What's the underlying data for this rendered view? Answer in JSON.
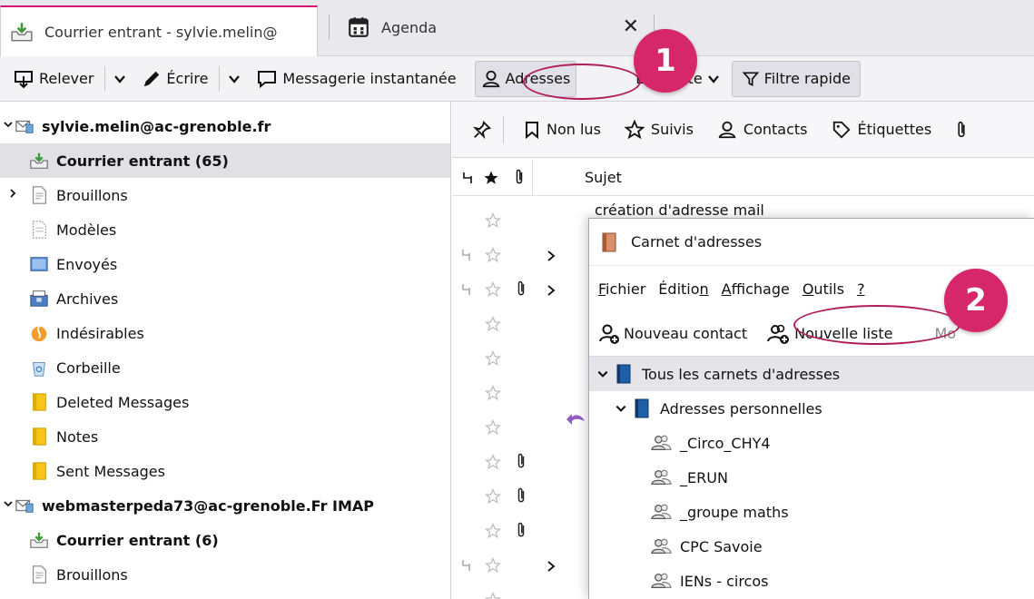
{
  "tabs": [
    {
      "label": "Courrier entrant - sylvie.melin@",
      "icon": "inbox-icon"
    },
    {
      "label": "Agenda",
      "icon": "calendar-icon",
      "close": "✕"
    }
  ],
  "toolbar": {
    "get_mail": "Relever",
    "write": "Écrire",
    "chat": "Messagerie instantanée",
    "address_book": "Adresses",
    "tag": "Étiquette",
    "quick_filter": "Filtre rapide"
  },
  "folders": [
    {
      "label": "sylvie.melin@ac-grenoble.fr",
      "icon": "account-icon",
      "bold": true,
      "twisty": "v",
      "indent": 0
    },
    {
      "label": "Courrier entrant (65)",
      "icon": "inbox-icon",
      "bold": true,
      "selected": true,
      "indent": 1
    },
    {
      "label": "Brouillons",
      "icon": "drafts-icon",
      "twisty": ">",
      "indent": 1
    },
    {
      "label": "Modèles",
      "icon": "templates-icon",
      "indent": 1
    },
    {
      "label": "Envoyés",
      "icon": "sent-icon",
      "indent": 1
    },
    {
      "label": "Archives",
      "icon": "archive-icon",
      "indent": 1
    },
    {
      "label": "Indésirables",
      "icon": "junk-icon",
      "indent": 1
    },
    {
      "label": "Corbeille",
      "icon": "trash-icon",
      "indent": 1
    },
    {
      "label": "Deleted Messages",
      "icon": "folder-icon",
      "indent": 1
    },
    {
      "label": "Notes",
      "icon": "folder-icon",
      "indent": 1
    },
    {
      "label": "Sent Messages",
      "icon": "folder-icon",
      "indent": 1
    },
    {
      "label": "webmasterpeda73@ac-grenoble.Fr IMAP",
      "icon": "account-icon",
      "bold": true,
      "twisty": "v",
      "indent": 0
    },
    {
      "label": "Courrier entrant (6)",
      "icon": "inbox-icon",
      "bold": true,
      "indent": 1
    },
    {
      "label": "Brouillons",
      "icon": "drafts-icon",
      "indent": 1
    }
  ],
  "quick_filter_bar": {
    "unread": "Non lus",
    "starred": "Suivis",
    "contacts": "Contacts",
    "tags": "Étiquettes"
  },
  "thread_columns": {
    "subject": "Sujet"
  },
  "thread_first_subject": "création d'adresse mail",
  "address_book": {
    "title": "Carnet d'adresses",
    "menu": [
      {
        "label": "Fichier",
        "key": "F",
        "rest": "ichier"
      },
      {
        "label": "Édition",
        "pre": "Éditio",
        "key": "n",
        "rest": ""
      },
      {
        "label": "Affichage",
        "key": "A",
        "rest": "ffichage"
      },
      {
        "label": "Outils",
        "key": "O",
        "rest": "utils"
      },
      {
        "label": "?",
        "key": "?",
        "rest": ""
      }
    ],
    "new_contact": "Nouveau contact",
    "new_list": "Nouvelle liste",
    "truncated_btn": "Mo",
    "tree": [
      {
        "label": "Tous les carnets d'adresses",
        "selected": true,
        "twisty": "v",
        "indent": 0,
        "icon": "addressbook-icon"
      },
      {
        "label": "Adresses personnelles",
        "twisty": "v",
        "indent": 1,
        "icon": "addressbook-icon"
      },
      {
        "label": "_Circo_CHY4",
        "indent": 2,
        "icon": "mailing-list-icon"
      },
      {
        "label": "_ERUN",
        "indent": 2,
        "icon": "mailing-list-icon"
      },
      {
        "label": "_groupe maths",
        "indent": 2,
        "icon": "mailing-list-icon"
      },
      {
        "label": "CPC Savoie",
        "indent": 2,
        "icon": "mailing-list-icon"
      },
      {
        "label": "IENs - circos",
        "indent": 2,
        "icon": "mailing-list-icon"
      }
    ]
  },
  "annotations": [
    {
      "label": "1"
    },
    {
      "label": "2"
    }
  ],
  "colors": {
    "accent": "#d6276a",
    "selection": "#e0e0e5",
    "folder_yellow": "#f5c518",
    "inbox_green": "#3c9a3c"
  }
}
